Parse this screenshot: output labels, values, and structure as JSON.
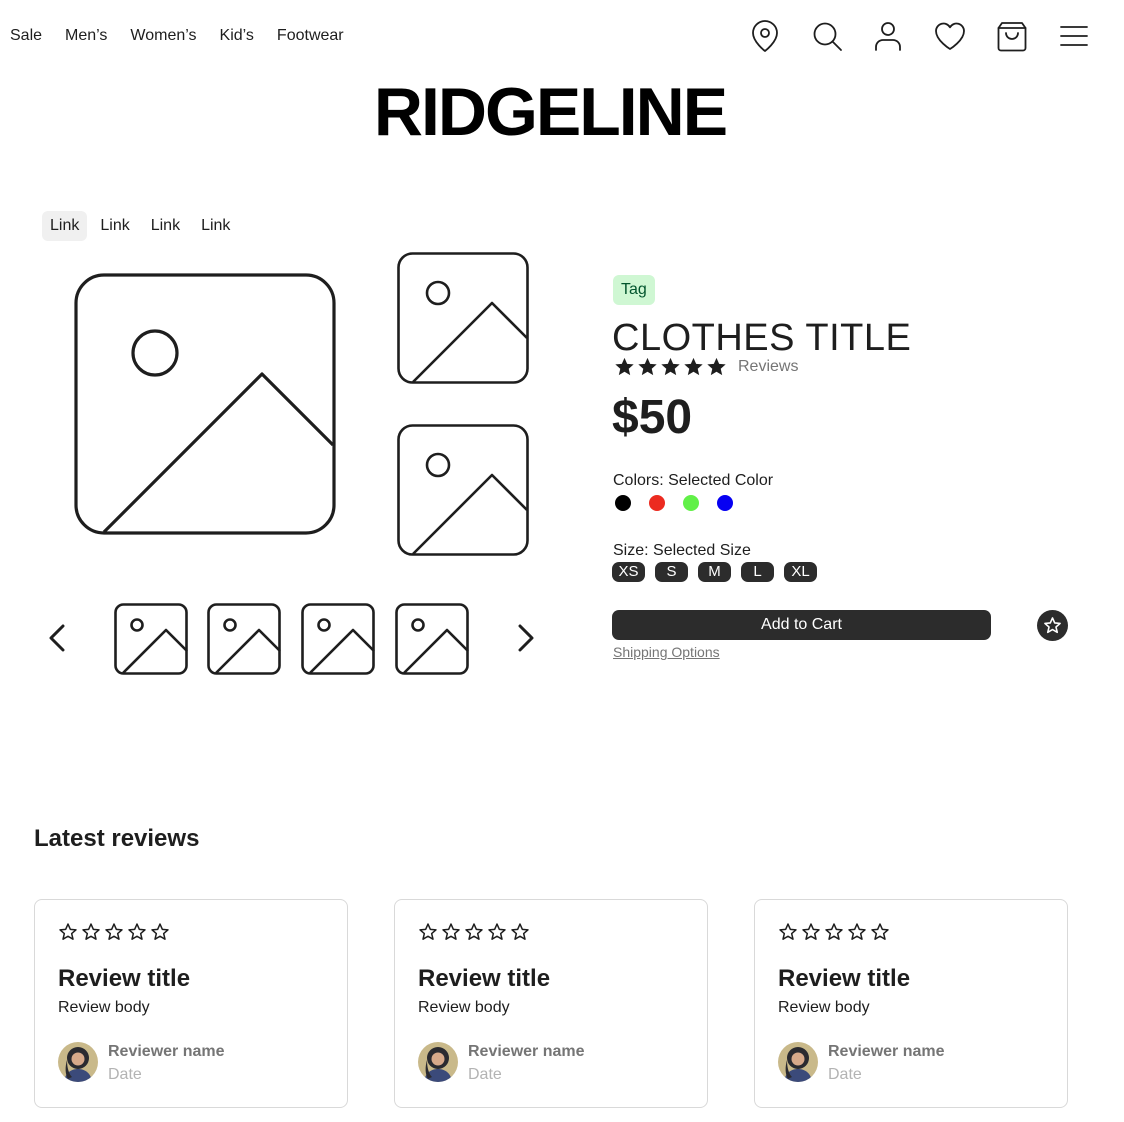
{
  "nav": {
    "links": [
      "Sale",
      "Men’s",
      "Women’s",
      "Kid’s",
      "Footwear"
    ],
    "icons": [
      "location-pin-icon",
      "search-icon",
      "user-icon",
      "heart-icon",
      "shopping-bag-icon",
      "menu-icon"
    ]
  },
  "brand": "RIDGELINE",
  "tabs": [
    "Link",
    "Link",
    "Link",
    "Link"
  ],
  "product": {
    "tag": "Tag",
    "title": "CLOTHES TITLE",
    "rating": 5,
    "reviews_link": "Reviews",
    "price": "$50",
    "colors_label": "Colors: Selected Color",
    "colors": [
      "#000000",
      "#ec2b20",
      "#61f048",
      "#0600f2"
    ],
    "size_label": "Size: Selected Size",
    "sizes": [
      "XS",
      "S",
      "M",
      "L",
      "XL"
    ],
    "add_to_cart": "Add to Cart",
    "shipping": "Shipping Options"
  },
  "reviews": {
    "heading": "Latest reviews",
    "items": [
      {
        "title": "Review title",
        "body": "Review body",
        "name": "Reviewer name",
        "date": "Date"
      },
      {
        "title": "Review title",
        "body": "Review body",
        "name": "Reviewer name",
        "date": "Date"
      },
      {
        "title": "Review title",
        "body": "Review body",
        "name": "Reviewer name",
        "date": "Date"
      }
    ]
  },
  "colors": {
    "text": "#1e1e1e",
    "button": "#2c2c2c",
    "tag_bg": "#cff7d3",
    "tag_text": "#02542d",
    "muted": "#757575"
  }
}
